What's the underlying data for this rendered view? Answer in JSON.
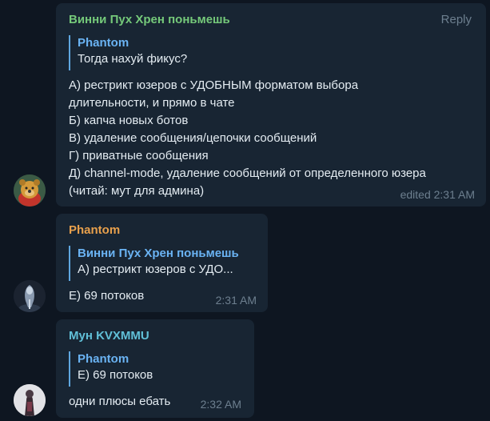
{
  "messages": [
    {
      "sender": "Винни Пух Хрен поньмешь",
      "sender_color": "#75c97a",
      "reply_label": "Reply",
      "quote": {
        "name": "Phantom",
        "text": "Тогда нахуй фикус?"
      },
      "lines": [
        "А) рестрикт юзеров с УДОБНЫМ форматом выбора",
        "длительности, и прямо в чате",
        "Б) капча новых ботов",
        "В) удаление сообщения/цепочки сообщений",
        "Г) приватные сообщения",
        "Д) channel-mode, удаление сообщений от определенного юзера",
        "(читай: мут для админа)"
      ],
      "time": "edited 2:31 AM",
      "avatar": "winnie-pooh-avatar"
    },
    {
      "sender": "Phantom",
      "sender_color": "#e8a04c",
      "quote": {
        "name": "Винни Пух Хрен поньмешь",
        "text": "А) рестрикт юзеров с УДО..."
      },
      "lines": [
        "Е) 69 потоков"
      ],
      "time": "2:31 AM",
      "avatar": "phantom-avatar"
    },
    {
      "sender": "Мун KVXMMU",
      "sender_color": "#61c0d8",
      "quote": {
        "name": "Phantom",
        "text": "Е) 69 потоков"
      },
      "lines": [
        "одни плюсы ебать"
      ],
      "time": "2:32 AM",
      "avatar": "mun-avatar"
    }
  ]
}
